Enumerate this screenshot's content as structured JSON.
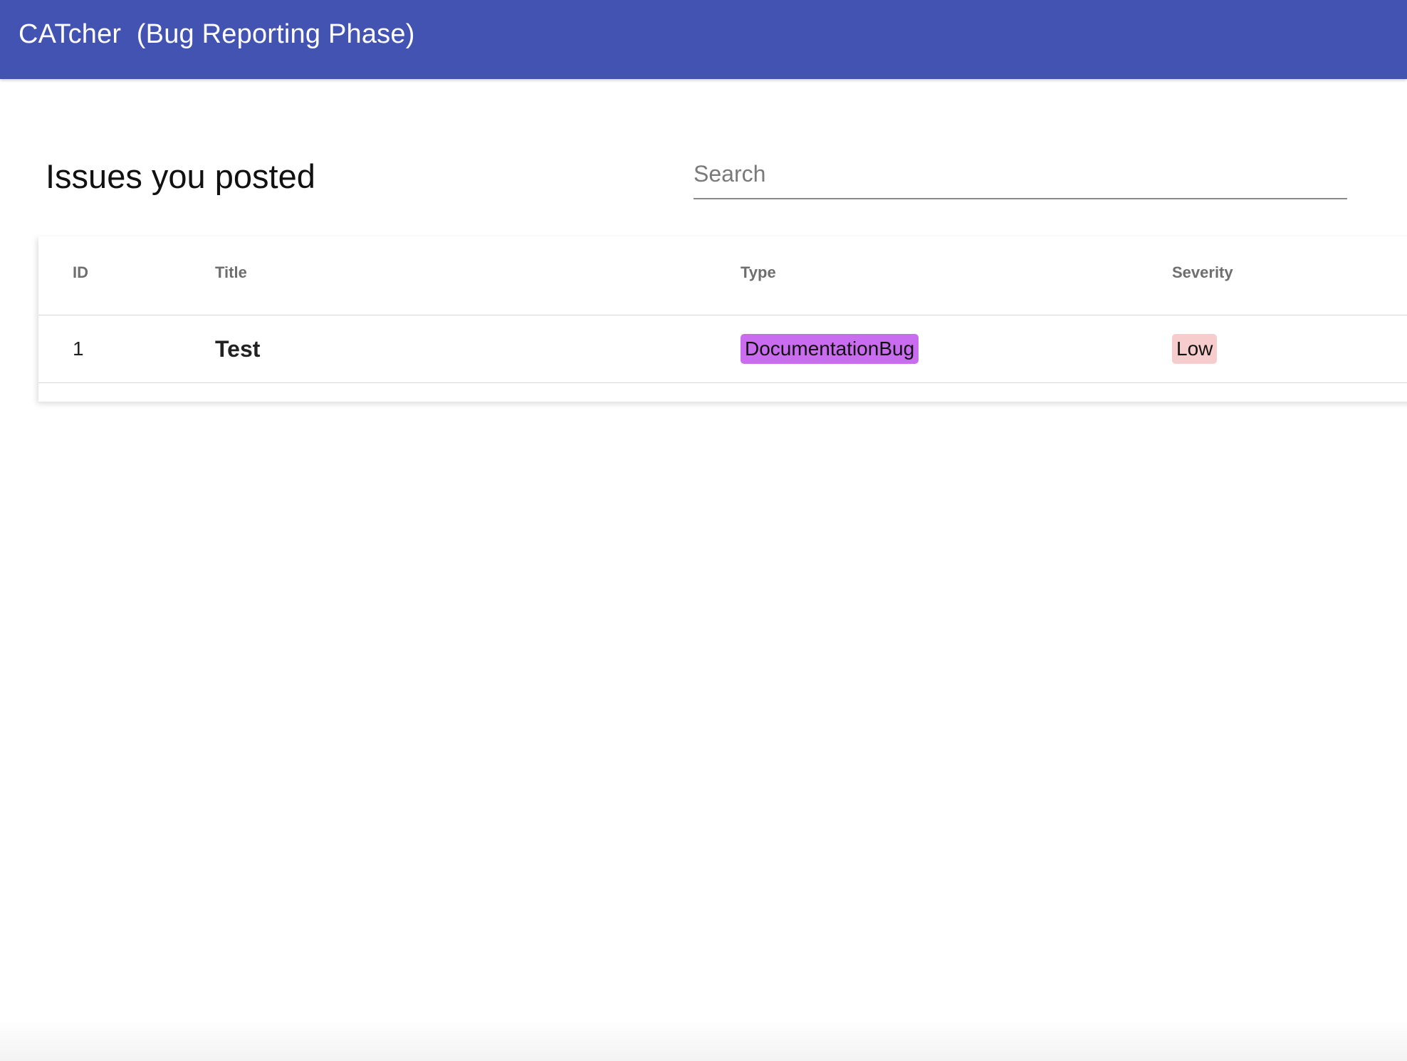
{
  "app": {
    "title": "CATcher  (Bug Reporting Phase)"
  },
  "page": {
    "heading": "Issues you posted"
  },
  "search": {
    "placeholder": "Search",
    "value": ""
  },
  "table": {
    "columns": {
      "id": "ID",
      "title": "Title",
      "type": "Type",
      "severity": "Severity"
    },
    "rows": [
      {
        "id": "1",
        "title": "Test",
        "type": "DocumentationBug",
        "severity": "Low"
      }
    ]
  },
  "colors": {
    "toolbar": "#4253b2",
    "type_documentation_bug": "#c96cf0",
    "severity_low": "#f6cccc"
  }
}
